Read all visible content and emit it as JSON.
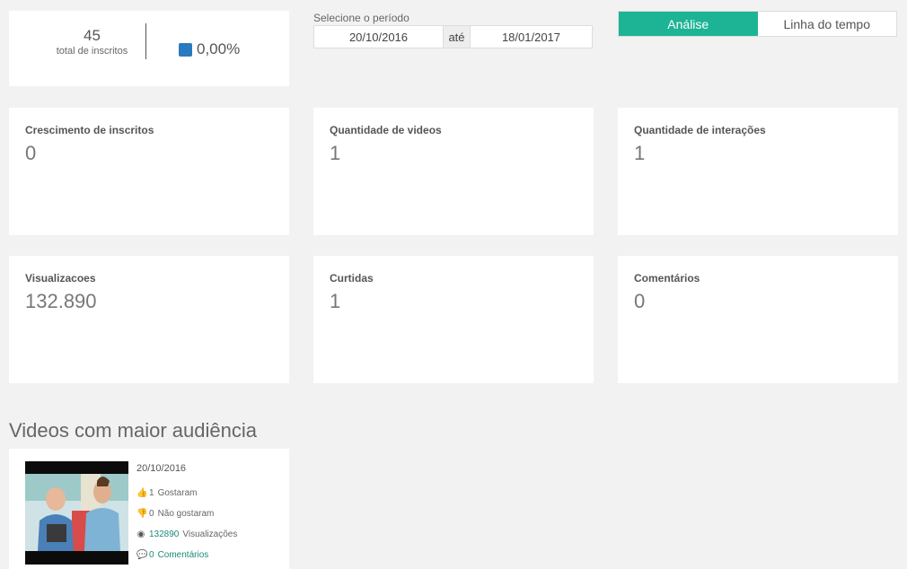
{
  "summary": {
    "total_subscribers": "45",
    "total_subscribers_label": "total de inscritos",
    "growth_percent": "0,00%",
    "growth_color": "#2a7ac0"
  },
  "period": {
    "label": "Selecione o período",
    "from": "20/10/2016",
    "separator": "até",
    "to": "18/01/2017"
  },
  "tabs": [
    {
      "label": "Análise",
      "active": true
    },
    {
      "label": "Linha do tempo",
      "active": false
    }
  ],
  "accent_color": "#1db395",
  "metrics": [
    {
      "title": "Crescimento de inscritos",
      "value": "0"
    },
    {
      "title": "Quantidade de videos",
      "value": "1"
    },
    {
      "title": "Quantidade de interações",
      "value": "1"
    },
    {
      "title": "Visualizacoes",
      "value": "132.890"
    },
    {
      "title": "Curtidas",
      "value": "1"
    },
    {
      "title": "Comentários",
      "value": "0"
    }
  ],
  "top_videos": {
    "title": "Videos com maior audiência",
    "items": [
      {
        "date": "20/10/2016",
        "likes": "1",
        "likes_label": "Gostaram",
        "dislikes": "0",
        "dislikes_label": "Não gostaram",
        "views": "132890",
        "views_label": "Visualizações",
        "comments": "0",
        "comments_label": "Comentários",
        "icons": [
          "thumbs-up-icon",
          "thumbs-down-icon",
          "eye-icon",
          "comment-icon"
        ]
      }
    ]
  }
}
